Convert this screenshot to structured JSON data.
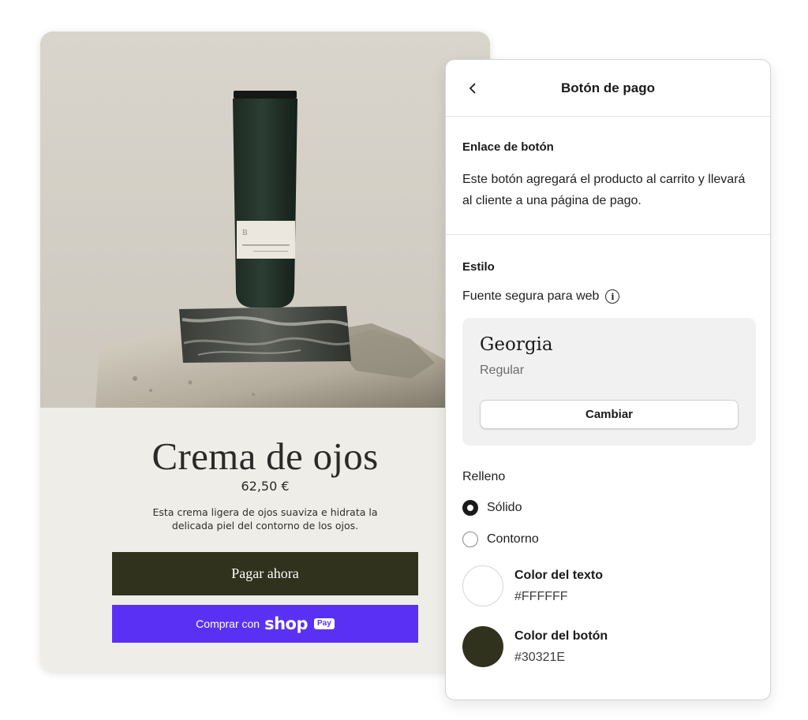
{
  "product": {
    "title": "Crema de ojos",
    "price": "62,50 €",
    "description": "Esta crema ligera de ojos suaviza e hidrata la delicada piel del contorno de los ojos.",
    "pay_now_label": "Pagar ahora",
    "shop_pay": {
      "prefix": "Comprar con",
      "logo_text": "shop",
      "badge": "Pay",
      "color": "#5a31f4"
    },
    "photo_icon": "product-tube-on-stone-photo"
  },
  "panel": {
    "back_icon": "chevron-left-icon",
    "title": "Botón de pago",
    "link_section": {
      "heading": "Enlace de botón",
      "text": "Este botón agregará el producto al carrito y llevará al cliente a una página de pago."
    },
    "style_section": {
      "heading": "Estilo",
      "font_label": "Fuente segura para web",
      "font_name": "Georgia",
      "font_weight": "Regular",
      "change_label": "Cambiar"
    },
    "fill_section": {
      "heading": "Relleno",
      "options": [
        {
          "label": "Sólido",
          "selected": true
        },
        {
          "label": "Contorno",
          "selected": false
        }
      ]
    },
    "colors": {
      "text_color": {
        "label": "Color del texto",
        "value": "#FFFFFF"
      },
      "button_color": {
        "label": "Color del botón",
        "value": "#30321E"
      }
    }
  }
}
